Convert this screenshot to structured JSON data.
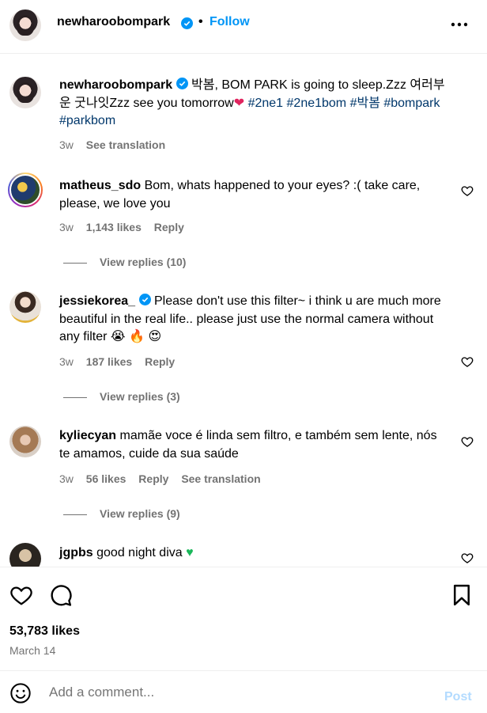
{
  "header": {
    "username": "newharoobompark",
    "separator": "•",
    "follow_label": "Follow",
    "more_label": "•••"
  },
  "caption": {
    "username": "newharoobompark",
    "text": "박봄, BOM PARK is going to sleep.Zzz 여러부운 굿나잇Zzz see you tomorrow",
    "tags": "#2ne1 #2ne1bom #박봄 #bompark #parkbom",
    "time": "3w",
    "translate": "See translation"
  },
  "comments": [
    {
      "username": "matheus_sdo",
      "text": "Bom, whats happened to your eyes? :( take care, please, we love you",
      "time": "3w",
      "likes": "1,143 likes",
      "reply": "Reply",
      "view_replies": "View replies (10)"
    },
    {
      "username": "jessiekorea_",
      "text": "Please don't use this filter~ i think u are much more beautiful in the real life.. please just use the normal camera without any filter",
      "time": "3w",
      "likes": "187 likes",
      "reply": "Reply",
      "view_replies": "View replies (3)"
    },
    {
      "username": "kyliecyan",
      "text": "mamãe voce é linda sem filtro, e também sem lente, nós te amamos, cuide da sua saúde",
      "time": "3w",
      "likes": "56 likes",
      "reply": "Reply",
      "translate": "See translation",
      "view_replies": "View replies (9)"
    },
    {
      "username": "jgpbs",
      "text": "good night diva"
    }
  ],
  "post": {
    "likes": "53,783 likes",
    "date": "March 14"
  },
  "comment_box": {
    "placeholder": "Add a comment...",
    "post_label": "Post"
  },
  "colors": {
    "link_blue": "#0095f6",
    "hashtag": "#00376b",
    "secondary": "#737373",
    "post_disabled": "#b3dbff"
  }
}
